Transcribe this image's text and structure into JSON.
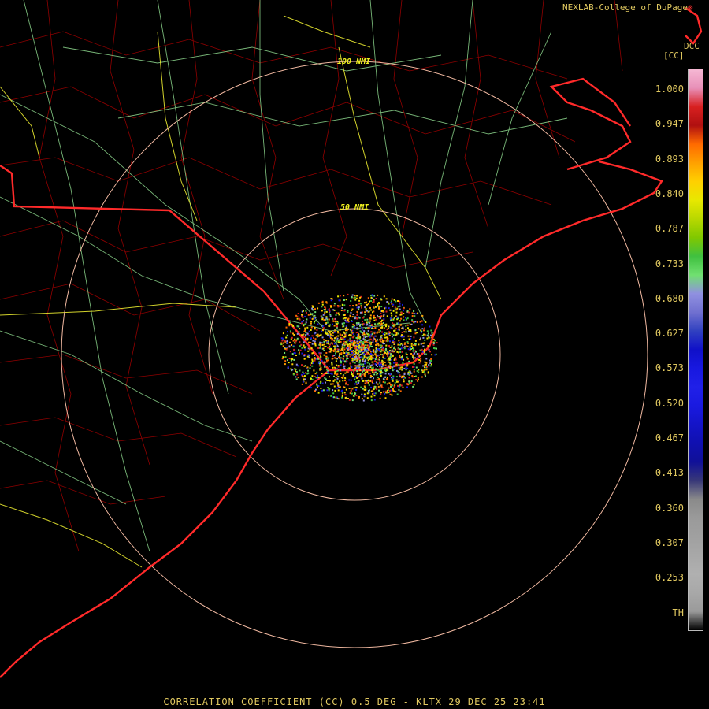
{
  "header": {
    "credit": "NEXLAB-College of DuPage",
    "site_code": "DCC",
    "unit": "[CC]"
  },
  "range_rings": [
    {
      "label": "100 NMI"
    },
    {
      "label": "50 NMI"
    }
  ],
  "legend": {
    "ticks": [
      "1.000",
      "0.947",
      "0.893",
      "0.840",
      "0.787",
      "0.733",
      "0.680",
      "0.627",
      "0.573",
      "0.520",
      "0.467",
      "0.413",
      "0.360",
      "0.307",
      "0.253",
      "TH"
    ]
  },
  "footer": {
    "caption": "CORRELATION COEFFICIENT (CC) 0.5 DEG - KLTX 29 DEC 25 23:41"
  },
  "colors": {
    "background": "#000000",
    "state_border": "#ff2a2a",
    "county_lines": "#b00000",
    "highways": "#8ed88e",
    "interstates": "#e8e830",
    "range_rings": "#f0b8a0",
    "text": "#e0c860",
    "ring_label": "#f0f020"
  }
}
